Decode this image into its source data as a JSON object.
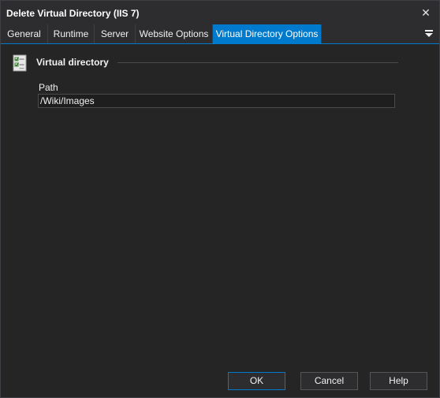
{
  "window": {
    "title": "Delete Virtual Directory (IIS 7)",
    "close_glyph": "✕"
  },
  "tabs": [
    {
      "label": "General"
    },
    {
      "label": "Runtime"
    },
    {
      "label": "Server"
    },
    {
      "label": "Website Options"
    },
    {
      "label": "Virtual Directory Options",
      "active": true
    }
  ],
  "section": {
    "title": "Virtual directory",
    "icon": "checklist-icon"
  },
  "path": {
    "label": "Path",
    "value": "/Wiki/Images"
  },
  "buttons": {
    "ok": "OK",
    "cancel": "Cancel",
    "help": "Help"
  },
  "colors": {
    "accent": "#007acc",
    "background": "#252526",
    "titlebar": "#2d2d30"
  }
}
